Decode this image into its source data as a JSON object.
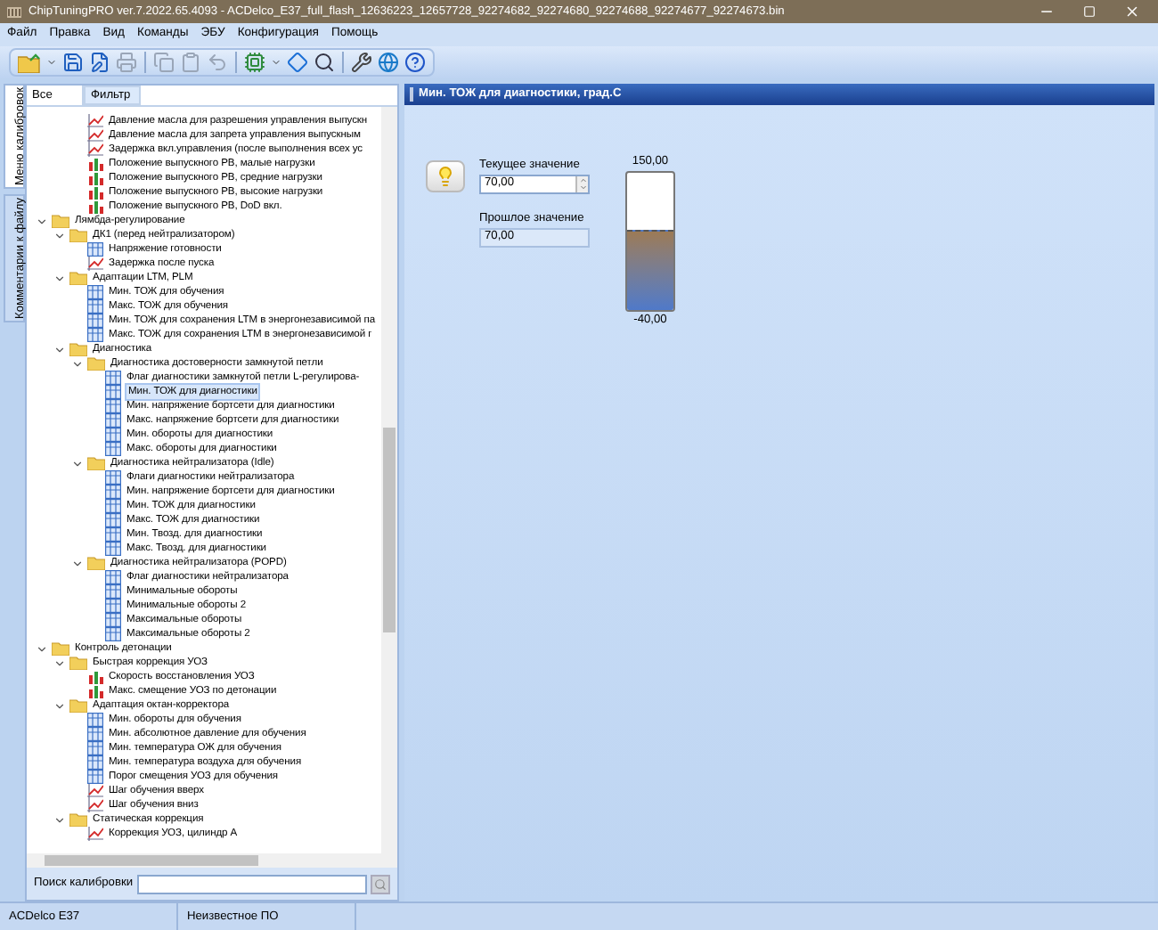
{
  "window": {
    "title": "ChipTuningPRO ver.7.2022.65.4093 - ACDelco_E37_full_flash_12636223_12657728_92274682_92274680_92274688_92274677_92274673.bin"
  },
  "menu": [
    "Файл",
    "Правка",
    "Вид",
    "Команды",
    "ЭБУ",
    "Конфигурация",
    "Помощь"
  ],
  "toolbar": [
    {
      "kind": "open",
      "disabled": false
    },
    {
      "kind": "caret",
      "disabled": false
    },
    {
      "kind": "save",
      "disabled": false
    },
    {
      "kind": "save-as",
      "disabled": false
    },
    {
      "kind": "print",
      "disabled": true
    },
    {
      "kind": "sep"
    },
    {
      "kind": "copy",
      "disabled": true
    },
    {
      "kind": "paste",
      "disabled": true
    },
    {
      "kind": "undo",
      "disabled": true
    },
    {
      "kind": "sep"
    },
    {
      "kind": "chip",
      "disabled": false
    },
    {
      "kind": "caret",
      "disabled": false
    },
    {
      "kind": "diamond",
      "disabled": false
    },
    {
      "kind": "search",
      "disabled": false
    },
    {
      "kind": "sep"
    },
    {
      "kind": "tools",
      "disabled": false
    },
    {
      "kind": "globe",
      "disabled": false
    },
    {
      "kind": "help",
      "disabled": false
    }
  ],
  "side_tabs": [
    {
      "label": "Меню калибровок",
      "selected": true
    },
    {
      "label": "Комментарии к файлу",
      "selected": false
    }
  ],
  "tree_tabs": [
    {
      "label": "Все",
      "selected": false
    },
    {
      "label": "Фильтр",
      "selected": true
    }
  ],
  "tree": [
    {
      "children": [
        {
          "children": [
            {
              "label": "Давление масла для разрешения управления выпускн",
              "kind": "curve",
              "selected": false
            },
            {
              "label": "Давление масла для запрета управления выпускным",
              "kind": "curve",
              "selected": false
            },
            {
              "label": "Задержка вкл.управления (после выполнения всех ус",
              "kind": "curve",
              "selected": false
            },
            {
              "label": "Положение выпускного РВ, малые нагрузки",
              "kind": "map",
              "selected": false
            },
            {
              "label": "Положение выпускного РВ, средние нагрузки",
              "kind": "map",
              "selected": false
            },
            {
              "label": "Положение выпускного РВ, высокие нагрузки",
              "kind": "map",
              "selected": false
            },
            {
              "label": "Положение выпускного РВ, DoD вкл.",
              "kind": "map",
              "selected": false
            }
          ]
        }
      ]
    },
    {
      "label": "Лямбда-регулирование",
      "kind": "folder",
      "expanded": true,
      "children": [
        {
          "label": "ДК1 (перед нейтрализатором)",
          "kind": "folder",
          "expanded": true,
          "children": [
            {
              "label": "Напряжение готовности",
              "kind": "table",
              "selected": false
            },
            {
              "label": "Задержка после пуска",
              "kind": "curve",
              "selected": false
            }
          ]
        },
        {
          "label": "Адаптации LTM, PLM",
          "kind": "folder",
          "expanded": true,
          "children": [
            {
              "label": "Мин. ТОЖ для обучения",
              "kind": "table",
              "selected": false
            },
            {
              "label": "Макс. ТОЖ для обучения",
              "kind": "table",
              "selected": false
            },
            {
              "label": "Мин. ТОЖ для сохранения LTM в энергонезависимой па",
              "kind": "table",
              "selected": false
            },
            {
              "label": "Макс. ТОЖ для сохранения LTM в энергонезависимой г",
              "kind": "table",
              "selected": false
            }
          ]
        },
        {
          "label": "Диагностика",
          "kind": "folder",
          "expanded": true,
          "children": [
            {
              "label": "Диагностика достоверности замкнутой петли",
              "kind": "folder",
              "expanded": true,
              "children": [
                {
                  "label": "Флаг диагностики замкнутой петли L-регулирова-",
                  "kind": "table",
                  "selected": false
                },
                {
                  "label": "Мин. ТОЖ для диагностики",
                  "kind": "table",
                  "selected": true
                },
                {
                  "label": "Мин. напряжение бортсети для диагностики",
                  "kind": "table",
                  "selected": false
                },
                {
                  "label": "Макс. напряжение бортсети для диагностики",
                  "kind": "table",
                  "selected": false
                },
                {
                  "label": "Мин. обороты для диагностики",
                  "kind": "table",
                  "selected": false
                },
                {
                  "label": "Макс. обороты для диагностики",
                  "kind": "table",
                  "selected": false
                }
              ]
            },
            {
              "label": "Диагностика нейтрализатора (Idle)",
              "kind": "folder",
              "expanded": true,
              "children": [
                {
                  "label": "Флаги диагностики нейтрализатора",
                  "kind": "table",
                  "selected": false
                },
                {
                  "label": "Мин. напряжение бортсети для диагностики",
                  "kind": "table",
                  "selected": false
                },
                {
                  "label": "Мин. ТОЖ для диагностики",
                  "kind": "table",
                  "selected": false
                },
                {
                  "label": "Макс. ТОЖ для диагностики",
                  "kind": "table",
                  "selected": false
                },
                {
                  "label": "Мин. Твозд. для диагностики",
                  "kind": "table",
                  "selected": false
                },
                {
                  "label": "Макс. Твозд. для диагностики",
                  "kind": "table",
                  "selected": false
                }
              ]
            },
            {
              "label": "Диагностика нейтрализатора (POPD)",
              "kind": "folder",
              "expanded": true,
              "children": [
                {
                  "label": "Флаг диагностики нейтрализатора",
                  "kind": "table",
                  "selected": false
                },
                {
                  "label": "Минимальные обороты",
                  "kind": "table",
                  "selected": false
                },
                {
                  "label": "Минимальные обороты 2",
                  "kind": "table",
                  "selected": false
                },
                {
                  "label": "Максимальные обороты",
                  "kind": "table",
                  "selected": false
                },
                {
                  "label": "Максимальные обороты 2",
                  "kind": "table",
                  "selected": false
                }
              ]
            }
          ]
        }
      ]
    },
    {
      "label": "Контроль детонации",
      "kind": "folder",
      "expanded": true,
      "children": [
        {
          "label": "Быстрая коррекция УОЗ",
          "kind": "folder",
          "expanded": true,
          "children": [
            {
              "label": "Скорость восстановления УОЗ",
              "kind": "map",
              "selected": false
            },
            {
              "label": "Макс. смещение УОЗ по детонации",
              "kind": "map",
              "selected": false
            }
          ]
        },
        {
          "label": "Адаптация октан-корректора",
          "kind": "folder",
          "expanded": true,
          "children": [
            {
              "label": "Мин. обороты для обучения",
              "kind": "table",
              "selected": false
            },
            {
              "label": "Мин. абсолютное давление для обучения",
              "kind": "table",
              "selected": false
            },
            {
              "label": "Мин. температура ОЖ для обучения",
              "kind": "table",
              "selected": false
            },
            {
              "label": "Мин. температура воздуха для обучения",
              "kind": "table",
              "selected": false
            },
            {
              "label": "Порог смещения УОЗ для обучения",
              "kind": "table",
              "selected": false
            },
            {
              "label": "Шаг обучения вверх",
              "kind": "curve",
              "selected": false
            },
            {
              "label": "Шаг обучения вниз",
              "kind": "curve",
              "selected": false
            }
          ]
        },
        {
          "label": "Статическая коррекция",
          "kind": "folder",
          "expanded": true,
          "children": [
            {
              "label": "Коррекция УОЗ, цилиндр А",
              "kind": "curve",
              "selected": false
            }
          ]
        }
      ]
    }
  ],
  "search": {
    "label": "Поиск калибровки"
  },
  "editor": {
    "title": "Мин. ТОЖ для диагностики, град.С",
    "current_label": "Текущее значение",
    "current_value": "70,00",
    "previous_label": "Прошлое значение",
    "previous_value": "70,00",
    "max": "150,00",
    "min": "-40,00",
    "level": 0.58
  },
  "status_bar": [
    "ACDelco E37",
    "Неизвестное ПО"
  ]
}
